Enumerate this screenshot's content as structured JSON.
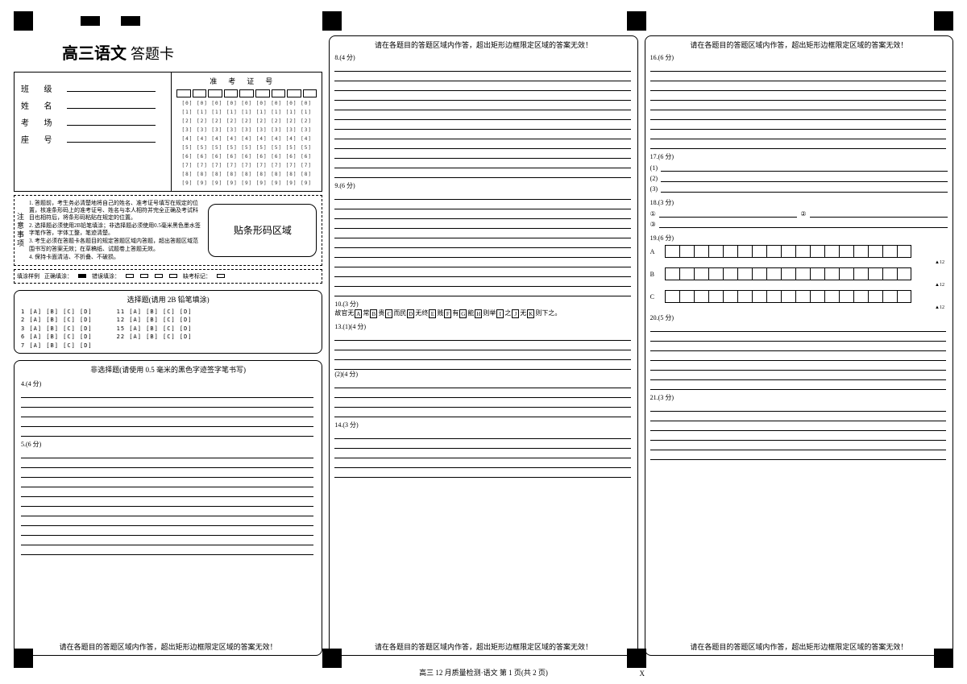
{
  "title_main": "高三语文",
  "title_sub": "答题卡",
  "info": {
    "class_label": "班 级",
    "name_label": "姓 名",
    "room_label": "考 场",
    "seat_label": "座 号",
    "exam_id_label": "准考证号"
  },
  "notice": {
    "label": "注意事项",
    "lines": [
      "1. 答题前，考生务必清楚地将自己的姓名、准考证号填写在规定的位置，核准条形码上的准考证号、姓名与本人相符并完全正确及考试科目也相符后，将条形码粘贴在规定的位置。",
      "2. 选择题必须使用2B铅笔填涂；非选择题必须使用0.5毫米黑色墨水签字笔作答，字体工整，笔迹清楚。",
      "3. 考生必须在答题卡各题目的规定答题区域内答题，超出答题区域范围书写的答案无效；在草稿纸、试题卷上答题无效。",
      "4. 保持卡面清洁、不折叠、不破损。"
    ]
  },
  "barcode_label": "贴条形码区域",
  "fill_sample": {
    "label": "填涂样例",
    "correct": "正确填涂：",
    "wrong": "错误填涂：",
    "absent": "缺考标记："
  },
  "mc": {
    "title": "选择题(请用 2B 铅笔填涂)",
    "col1": [
      "1",
      "2",
      "3",
      "6",
      "7"
    ],
    "col2": [
      "11",
      "12",
      "15",
      "22"
    ],
    "opts": " [A] [B] [C] [D]"
  },
  "nonmc_title": "非选择题(请使用 0.5 毫米的黑色字迹签字笔书写)",
  "panel_header": "请在各题目的答题区域内作答，超出矩形边框限定区域的答案无效！",
  "panel_footer": "请在各题目的答题区域内作答，超出矩形边框限定区域的答案无效！",
  "q4": "4.(4 分)",
  "q5": "5.(6 分)",
  "q8": "8.(4 分)",
  "q9": "9.(6 分)",
  "q10_label": "10.(3 分)",
  "q10_text_parts": [
    "故官无",
    "常",
    "贵",
    "而民",
    "无终",
    "贱",
    "有",
    "能",
    "则举",
    "之",
    "无",
    "则",
    "下之。"
  ],
  "q10_letters": [
    "A",
    "B",
    "C",
    "D",
    "E",
    "F",
    "G",
    "H",
    "I",
    "J",
    "K"
  ],
  "q13": "13.(1)(4 分)",
  "q13b": "(2)(4 分)",
  "q14": "14.(3 分)",
  "q16": "16.(6 分)",
  "q17": "17.(6 分)",
  "q17_subs": [
    "(1)",
    "(2)",
    "(3)"
  ],
  "q18": "18.(3 分)",
  "q18_subs": [
    "①",
    "②",
    "③"
  ],
  "q19": "19.(6 分)",
  "q19_rows": [
    "A",
    "B",
    "C"
  ],
  "q19_marker": "▲12",
  "q20": "20.(5 分)",
  "q21": "21.(3 分)",
  "footer": "高三 12 月质量检测·语文 第 1 页(共 2 页)",
  "footer_x": "X"
}
